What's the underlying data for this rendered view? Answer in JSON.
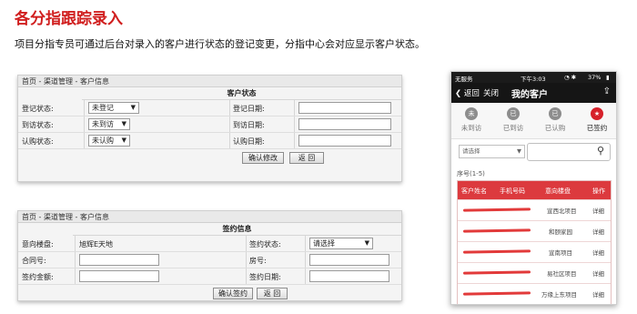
{
  "heading": "各分指跟踪录入",
  "subtitle": "项目分指专员可通过后台对录入的客户进行状态的登记变更，分指中心会对应显示客户状态。",
  "panel1": {
    "breadcrumb": "首页 - 渠道管理 - 客户信息",
    "section_title": "客户状态",
    "rows": [
      {
        "label": "登记状态:",
        "select": "未登记",
        "date_label": "登记日期:"
      },
      {
        "label": "到访状态:",
        "select": "未到访",
        "date_label": "到访日期:"
      },
      {
        "label": "认购状态:",
        "select": "未认购",
        "date_label": "认购日期:"
      }
    ],
    "confirm_button": "确认修改",
    "back_button": "返 回"
  },
  "panel2": {
    "breadcrumb": "首页 - 渠道管理 - 客户信息",
    "section_title": "签约信息",
    "project_label": "意向楼盘:",
    "project_value": "旭辉E天地",
    "sign_status_label": "签约状态:",
    "sign_status_select": "请选择",
    "contract_label": "合同号:",
    "room_label": "房号:",
    "amount_label": "签约金额:",
    "date_label": "签约日期:",
    "confirm_button": "确认签约",
    "back_button": "返 回"
  },
  "phone": {
    "status": {
      "carrier": "无服务",
      "time": "下午3:03",
      "battery": "37%"
    },
    "back": "返回",
    "close": "关闭",
    "title": "我的客户",
    "tabs": [
      {
        "label": "未到访",
        "icon": "未"
      },
      {
        "label": "已到访",
        "icon": "已"
      },
      {
        "label": "已认购",
        "icon": "已"
      },
      {
        "label": "已签约",
        "icon": "★"
      }
    ],
    "select_placeholder": "请选择",
    "seq_label": "序号(1-5)",
    "columns": [
      "客户姓名",
      "手机号码",
      "意向楼盘",
      "操作"
    ],
    "rows": [
      {
        "project": "宣西北项目",
        "action": "详细"
      },
      {
        "project": "和颐家园",
        "action": "详细"
      },
      {
        "project": "宣南项目",
        "action": "详细"
      },
      {
        "project": "易社区项目",
        "action": "详细"
      },
      {
        "project": "万缘上东项目",
        "action": "详细"
      }
    ]
  }
}
